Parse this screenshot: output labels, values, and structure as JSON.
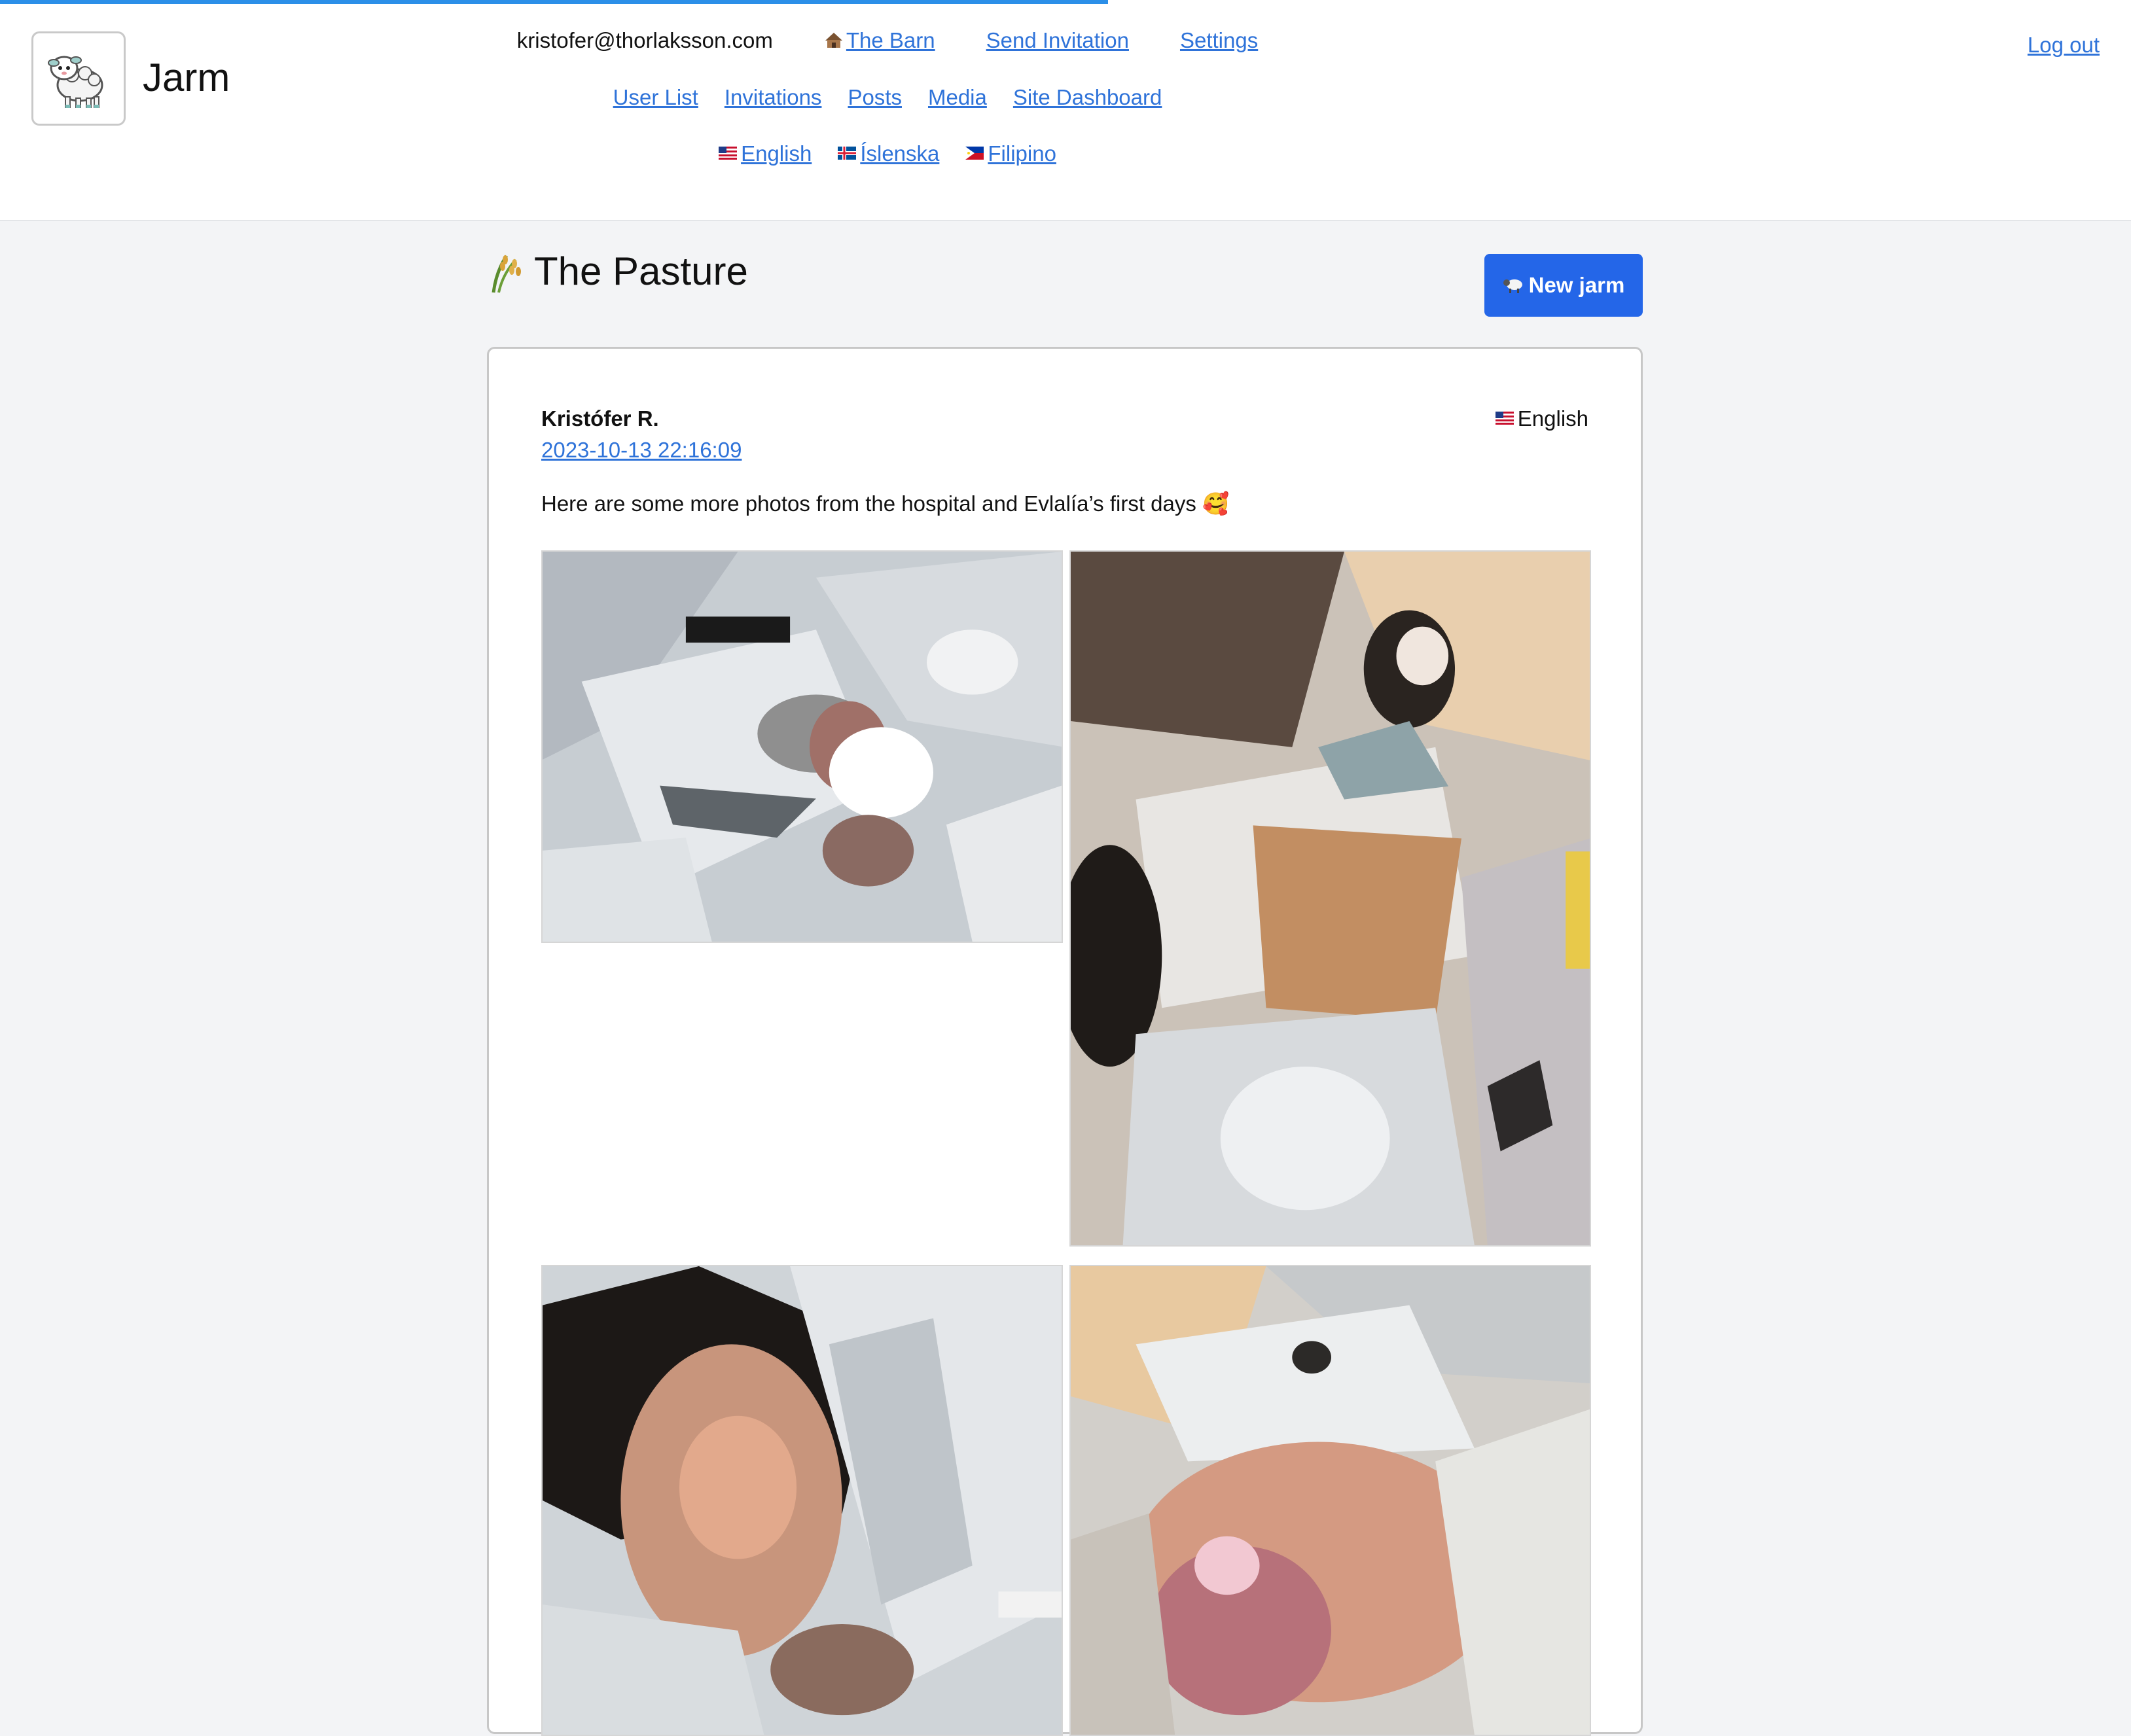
{
  "app": {
    "name": "Jarm"
  },
  "nav": {
    "email": "kristofer@thorlaksson.com",
    "barn": "The Barn",
    "send_invitation": "Send Invitation",
    "settings": "Settings",
    "logout": "Log out",
    "admin_links": [
      "User List",
      "Invitations",
      "Posts",
      "Media",
      "Site Dashboard"
    ],
    "languages": [
      "English",
      "Íslenska",
      "Filipino"
    ]
  },
  "page": {
    "title": "The Pasture",
    "new_button": "New jarm"
  },
  "post": {
    "author": "Kristófer R.",
    "date": "2023-10-13 22:16:09",
    "language": "English",
    "text": "Here are some more photos from the hospital and Evlalía’s first days 🥰"
  },
  "progress": 0.52,
  "icons": {
    "logo": "lamb-logo-icon",
    "barn": "hut-icon",
    "title": "rice-sheaf-icon",
    "new_button": "sheep-icon",
    "flags": [
      "us-flag-icon",
      "iceland-flag-icon",
      "philippines-flag-icon"
    ]
  }
}
